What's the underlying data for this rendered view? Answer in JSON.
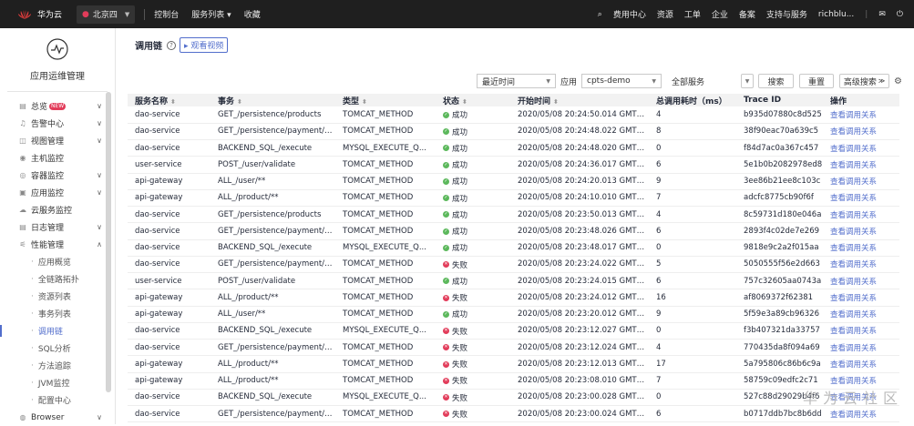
{
  "topbar": {
    "brand": "华为云",
    "region": "北京四",
    "nav": [
      "控制台",
      "服务列表 ▾",
      "收藏"
    ],
    "right": [
      "费用中心",
      "资源",
      "工单",
      "企业",
      "备案",
      "支持与服务",
      "richblu..."
    ]
  },
  "sidebar": {
    "title": "应用运维管理",
    "items": [
      {
        "label": "总览",
        "icon": "overview-icon",
        "arrow": "∨",
        "badge": "NEW"
      },
      {
        "label": "告警中心",
        "icon": "bell-icon",
        "arrow": "∨"
      },
      {
        "label": "视图管理",
        "icon": "view-icon",
        "arrow": "∨"
      },
      {
        "label": "主机监控",
        "icon": "host-icon",
        "arrow": ""
      },
      {
        "label": "容器监控",
        "icon": "container-icon",
        "arrow": "∨"
      },
      {
        "label": "应用监控",
        "icon": "app-icon",
        "arrow": "∨"
      },
      {
        "label": "云服务监控",
        "icon": "cloud-icon",
        "arrow": ""
      },
      {
        "label": "日志管理",
        "icon": "log-icon",
        "arrow": "∨"
      },
      {
        "label": "性能管理",
        "icon": "perf-icon",
        "arrow": "∧"
      }
    ],
    "subitems": [
      "应用概览",
      "全链路拓扑",
      "资源列表",
      "事务列表",
      "调用链",
      "SQL分析",
      "方法追踪",
      "JVM监控",
      "配置中心"
    ],
    "active_sub": "调用链",
    "last": "Browser"
  },
  "main": {
    "title": "调用链",
    "video": "观看视频",
    "filters": {
      "time": "最近时间",
      "app_label": "应用",
      "app": "cpts-demo",
      "service": "全部服务",
      "search": "搜索",
      "reset": "重置",
      "advanced": "高级搜索"
    },
    "columns": [
      "服务名称",
      "事务",
      "类型",
      "状态",
      "开始时间",
      "总调用耗时（ms）",
      "Trace ID",
      "操作"
    ],
    "rows": [
      [
        "dao-service",
        "GET_/persistence/products",
        "TOMCAT_METHOD",
        "成功",
        "2020/05/08 20:24:50.014 GMT+0...",
        "4",
        "b935d07880c8d525",
        "查看调用关系"
      ],
      [
        "dao-service",
        "GET_/persistence/payment/{...",
        "TOMCAT_METHOD",
        "成功",
        "2020/05/08 20:24:48.022 GMT+0...",
        "8",
        "38f90eac70a639c5",
        "查看调用关系"
      ],
      [
        "dao-service",
        "BACKEND_SQL_/execute",
        "MYSQL_EXECUTE_Q...",
        "成功",
        "2020/05/08 20:24:48.020 GMT+0...",
        "0",
        "f84d7ac0a367c457",
        "查看调用关系"
      ],
      [
        "user-service",
        "POST_/user/validate",
        "TOMCAT_METHOD",
        "成功",
        "2020/05/08 20:24:36.017 GMT+0...",
        "6",
        "5e1b0b2082978ed8",
        "查看调用关系"
      ],
      [
        "api-gateway",
        "ALL_/user/**",
        "TOMCAT_METHOD",
        "成功",
        "2020/05/08 20:24:20.013 GMT+0...",
        "9",
        "3ee86b21ee8c103c",
        "查看调用关系"
      ],
      [
        "api-gateway",
        "ALL_/product/**",
        "TOMCAT_METHOD",
        "成功",
        "2020/05/08 20:24:10.010 GMT+0...",
        "7",
        "adcfc8775cb90f6f",
        "查看调用关系"
      ],
      [
        "dao-service",
        "GET_/persistence/products",
        "TOMCAT_METHOD",
        "成功",
        "2020/05/08 20:23:50.013 GMT+0...",
        "4",
        "8c59731d180e046a",
        "查看调用关系"
      ],
      [
        "dao-service",
        "GET_/persistence/payment/{...",
        "TOMCAT_METHOD",
        "成功",
        "2020/05/08 20:23:48.026 GMT+0...",
        "6",
        "2893f4c02de7e269",
        "查看调用关系"
      ],
      [
        "dao-service",
        "BACKEND_SQL_/execute",
        "MYSQL_EXECUTE_Q...",
        "成功",
        "2020/05/08 20:23:48.017 GMT+0...",
        "0",
        "9818e9c2a2f015aa",
        "查看调用关系"
      ],
      [
        "dao-service",
        "GET_/persistence/payment/{...",
        "TOMCAT_METHOD",
        "失败",
        "2020/05/08 20:23:24.022 GMT+0...",
        "5",
        "5050555f56e2d663",
        "查看调用关系"
      ],
      [
        "user-service",
        "POST_/user/validate",
        "TOMCAT_METHOD",
        "成功",
        "2020/05/08 20:23:24.015 GMT+0...",
        "6",
        "757c32605aa0743a",
        "查看调用关系"
      ],
      [
        "api-gateway",
        "ALL_/product/**",
        "TOMCAT_METHOD",
        "失败",
        "2020/05/08 20:23:24.012 GMT+0...",
        "16",
        "af8069372f62381",
        "查看调用关系"
      ],
      [
        "api-gateway",
        "ALL_/user/**",
        "TOMCAT_METHOD",
        "成功",
        "2020/05/08 20:23:20.012 GMT+0...",
        "9",
        "5f59e3a89cb96326",
        "查看调用关系"
      ],
      [
        "dao-service",
        "BACKEND_SQL_/execute",
        "MYSQL_EXECUTE_Q...",
        "失败",
        "2020/05/08 20:23:12.027 GMT+0...",
        "0",
        "f3b407321da33757",
        "查看调用关系"
      ],
      [
        "dao-service",
        "GET_/persistence/payment/{...",
        "TOMCAT_METHOD",
        "失败",
        "2020/05/08 20:23:12.024 GMT+0...",
        "4",
        "770435da8f094a69",
        "查看调用关系"
      ],
      [
        "api-gateway",
        "ALL_/product/**",
        "TOMCAT_METHOD",
        "失败",
        "2020/05/08 20:23:12.013 GMT+0...",
        "17",
        "5a795806c86b6c9a",
        "查看调用关系"
      ],
      [
        "api-gateway",
        "ALL_/product/**",
        "TOMCAT_METHOD",
        "失败",
        "2020/05/08 20:23:08.010 GMT+0...",
        "7",
        "58759c09edfc2c71",
        "查看调用关系"
      ],
      [
        "dao-service",
        "BACKEND_SQL_/execute",
        "MYSQL_EXECUTE_Q...",
        "失败",
        "2020/05/08 20:23:00.028 GMT+0...",
        "0",
        "527c88d29029b4f6",
        "查看调用关系"
      ],
      [
        "dao-service",
        "GET_/persistence/payment/{...",
        "TOMCAT_METHOD",
        "失败",
        "2020/05/08 20:23:00.024 GMT+0...",
        "6",
        "b0717ddb7bc8b6dd",
        "查看调用关系"
      ]
    ]
  },
  "watermark": "华为云社区",
  "colors": {
    "accent": "#526ecc",
    "success": "#5cb85c",
    "fail": "#e23c5a",
    "topbar": "#1f1f1f"
  }
}
